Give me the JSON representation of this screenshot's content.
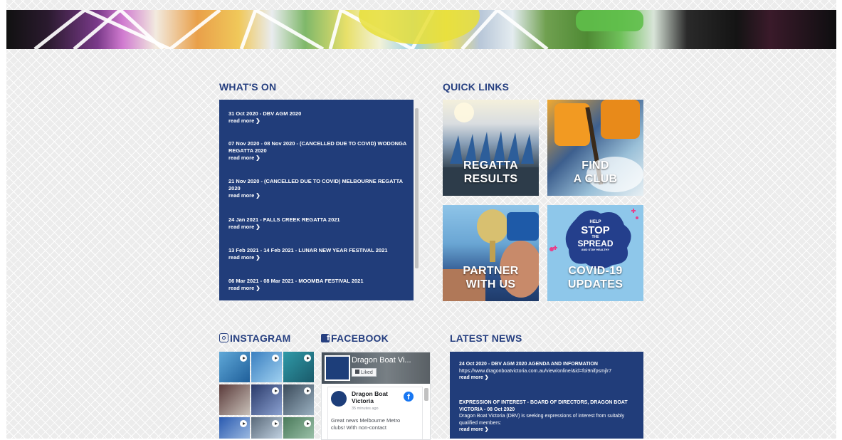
{
  "sections": {
    "whats_on": "WHAT'S ON",
    "quick_links": "QUICK LINKS",
    "instagram": "INSTAGRAM",
    "facebook": "FACEBOOK",
    "latest_news": "LATEST NEWS"
  },
  "events": [
    {
      "title": "31 Oct 2020 - DBV AGM 2020",
      "more": "read more ❯"
    },
    {
      "title": "07 Nov 2020 - 08 Nov 2020 - (CANCELLED DUE TO COVID) WODONGA REGATTA 2020",
      "more": "read more ❯"
    },
    {
      "title": "21 Nov 2020 - (CANCELLED DUE TO COVID) MELBOURNE REGATTA 2020",
      "more": "read more ❯"
    },
    {
      "title": "24 Jan 2021 - FALLS CREEK REGATTA 2021",
      "more": "read more ❯"
    },
    {
      "title": "13 Feb 2021 - 14 Feb 2021 - LUNAR NEW YEAR FESTIVAL 2021",
      "more": "read more ❯"
    },
    {
      "title": "06 Mar 2021 - 08 Mar 2021 - MOOMBA FESTIVAL 2021",
      "more": "read more ❯"
    }
  ],
  "quick_links": [
    {
      "line1": "REGATTA",
      "line2": "RESULTS"
    },
    {
      "line1": "FIND",
      "line2": "A CLUB"
    },
    {
      "line1": "PARTNER",
      "line2": "WITH US"
    },
    {
      "line1": "COVID-19",
      "line2": "UPDATES"
    }
  ],
  "covid_badge": {
    "help": "HELP",
    "stop": "STOP",
    "the": "THE",
    "spread": "SPREAD",
    "stay": "AND STAY HEALTHY"
  },
  "facebook": {
    "page_name": "Dragon Boat Vi...",
    "liked": "Liked",
    "post_author": "Dragon Boat Victoria",
    "post_time": "35 minutes ago",
    "post_text": "Great news Melbourne Metro clubs! With non-contact"
  },
  "news": [
    {
      "title": "24 Oct 2020 - DBV AGM 2020 AGENDA AND INFORMATION",
      "body": "https://www.dragonboatvictoria.com.au/view/online/&id=foi9nifpsmjlr7",
      "more": "read more ❯"
    },
    {
      "title": "EXPRESSION OF INTEREST - BOARD OF DIRECTORS, DRAGON BOAT VICTORIA - 08 Oct 2020",
      "body": "Dragon Boat Victoria (DBV) is seeking expressions of interest from suitably qualified members:",
      "more": "read more ❯"
    }
  ],
  "colors": {
    "navy": "#213d7a",
    "heading": "#263f80"
  }
}
